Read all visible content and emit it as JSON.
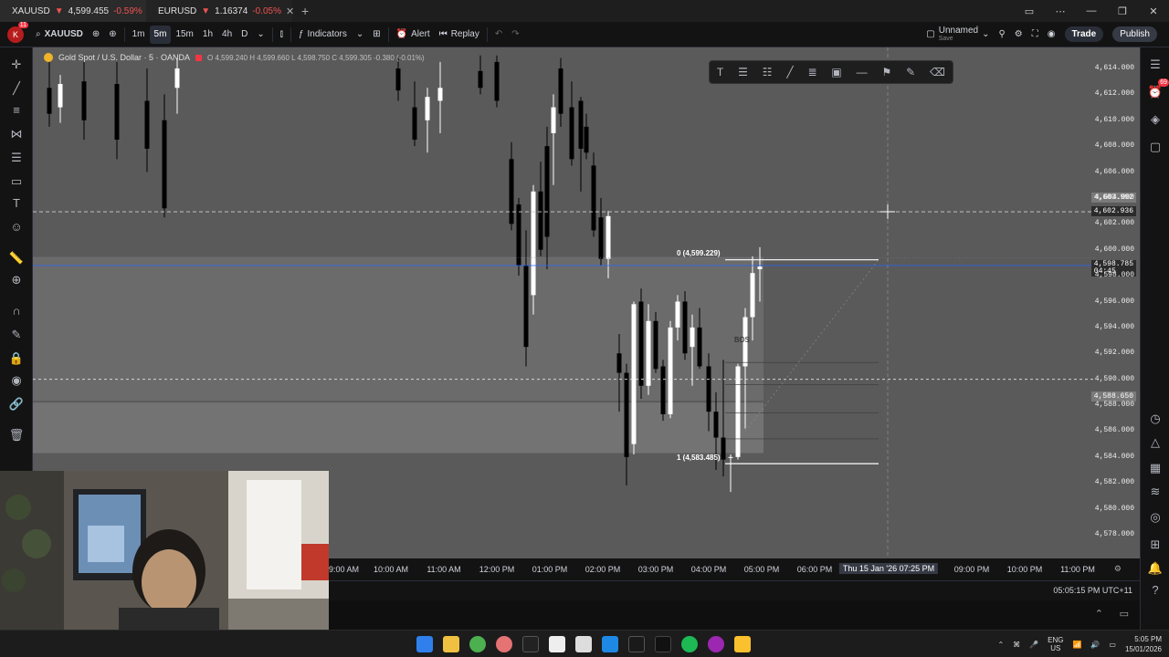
{
  "browser": {
    "tabs": [
      {
        "symbol": "XAUUSD",
        "price": "4,599.455",
        "change": "-0.59%"
      },
      {
        "symbol": "EURUSD",
        "price": "1.16374",
        "change": "-0.05%"
      }
    ]
  },
  "toolbar": {
    "avatar_badge": "11",
    "avatar_letter": "K",
    "symbol": "XAUUSD",
    "intervals": [
      "1m",
      "5m",
      "15m",
      "1h",
      "4h",
      "D"
    ],
    "selected_interval": "5m",
    "indicators": "Indicators",
    "alert": "Alert",
    "replay": "Replay",
    "layout_name": "Unnamed",
    "layout_status": "Save",
    "trade": "Trade",
    "publish": "Publish"
  },
  "legend": {
    "title": "Gold Spot / U.S. Dollar · 5 · OANDA",
    "ohlc": "O 4,599.240  H 4,599.660  L 4,598.750  C 4,599.305  -0.380 (-0.01%)"
  },
  "price_axis": {
    "ticks": [
      "4,614.000",
      "4,612.000",
      "4,610.000",
      "4,608.000",
      "4,606.000",
      "4,604.000",
      "4,602.000",
      "4,600.000",
      "4,598.000",
      "4,596.000",
      "4,594.000",
      "4,592.000",
      "4,590.000",
      "4,588.000",
      "4,586.000",
      "4,584.000",
      "4,582.000",
      "4,580.000",
      "4,578.000"
    ],
    "crosshair_price": "4,602.936",
    "high_marker": "4,603.992",
    "current_price": "4,598.785",
    "countdown": "04:45",
    "lower_marker": "4,588.650"
  },
  "fib": {
    "level0": "0 (4,599.229)",
    "level1": "1 (4,583.485)",
    "bos": "BOS"
  },
  "time_axis": {
    "labels": [
      "09:00 AM",
      "10:00 AM",
      "11:00 AM",
      "12:00 PM",
      "01:00 PM",
      "02:00 PM",
      "03:00 PM",
      "04:00 PM",
      "05:00 PM",
      "06:00 PM",
      "Thu 15 Jan '26",
      "07:25 PM",
      "09:00 PM",
      "10:00 PM",
      "11:00 PM"
    ],
    "highlight": "Thu 15 Jan '26   07:25 PM"
  },
  "status": {
    "clock": "05:05:15 PM UTC+11"
  },
  "taskbar": {
    "lang": "ENG",
    "region": "US",
    "time": "5:05 PM",
    "date": "15/01/2026"
  },
  "right_badge": "69",
  "colors": {
    "up": "#ffffff",
    "down": "#000000",
    "chart_bg": "#5a5a5a",
    "accent": "#2962ff",
    "negative": "#ef5350"
  }
}
